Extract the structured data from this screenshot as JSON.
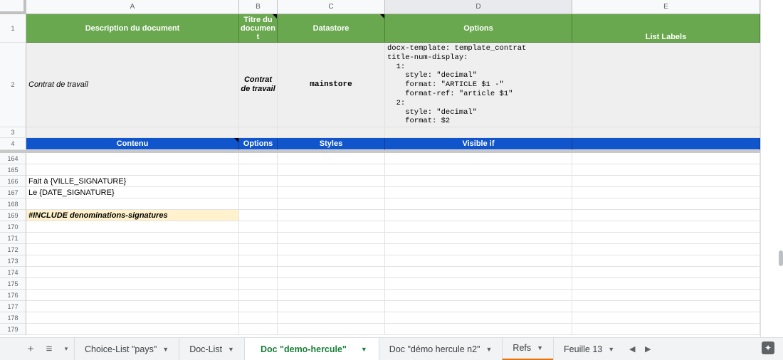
{
  "columns": [
    "A",
    "B",
    "C",
    "D",
    "E"
  ],
  "header_row": {
    "row_num": "1",
    "a": "Description du document",
    "b_lines": [
      "Titre du",
      "documen",
      "t"
    ],
    "c": "Datastore",
    "d": "Options",
    "e": "List Labels"
  },
  "row2": {
    "row_num": "2",
    "a": "Contrat de travail",
    "b_lines": [
      "Contrat",
      "de travail"
    ],
    "c": "mainstore",
    "d_lines": [
      "docx-template: template_contrat",
      "title-num-display:",
      "  1:",
      "    style: \"decimal\"",
      "    format: \"ARTICLE $1 -\"",
      "    format-ref: \"article $1\"",
      "  2:",
      "    style: \"decimal\"",
      "    format: $2"
    ]
  },
  "row3": {
    "row_num": "3"
  },
  "row4": {
    "row_num": "4",
    "a": "Contenu",
    "b": "Options",
    "c": "Styles",
    "d": "Visible if"
  },
  "data_rows": [
    {
      "num": "164",
      "a": ""
    },
    {
      "num": "165",
      "a": ""
    },
    {
      "num": "166",
      "a": "Fait à {VILLE_SIGNATURE}"
    },
    {
      "num": "167",
      "a": "Le {DATE_SIGNATURE}"
    },
    {
      "num": "168",
      "a": ""
    },
    {
      "num": "169",
      "a": "#INCLUDE  denominations-signatures",
      "highlight": true
    },
    {
      "num": "170",
      "a": ""
    },
    {
      "num": "171",
      "a": ""
    },
    {
      "num": "172",
      "a": ""
    },
    {
      "num": "173",
      "a": ""
    },
    {
      "num": "174",
      "a": ""
    },
    {
      "num": "175",
      "a": ""
    },
    {
      "num": "176",
      "a": ""
    },
    {
      "num": "177",
      "a": ""
    },
    {
      "num": "178",
      "a": ""
    },
    {
      "num": "179",
      "a": ""
    }
  ],
  "tabs": [
    {
      "label": "Choice-List \"pays\"",
      "active": false
    },
    {
      "label": "Doc-List",
      "active": false
    },
    {
      "label": "Doc \"demo-hercule\"",
      "active": true
    },
    {
      "label": "Doc \"démo hercule n2\"",
      "active": false
    },
    {
      "label": "Refs",
      "active": false,
      "orange": true
    },
    {
      "label": "Feuille 13",
      "active": false
    }
  ],
  "icons": {
    "add_sheet": "plus-icon",
    "all_sheets": "list-icon",
    "more": "caret-down-icon",
    "prev": "chevron-left-icon",
    "next": "chevron-right-icon",
    "explore": "explore-icon"
  },
  "colors": {
    "header_green": "#6aa84f",
    "header_blue": "#1155cc",
    "highlight": "#fff2cc",
    "active_tab": "#188038"
  }
}
